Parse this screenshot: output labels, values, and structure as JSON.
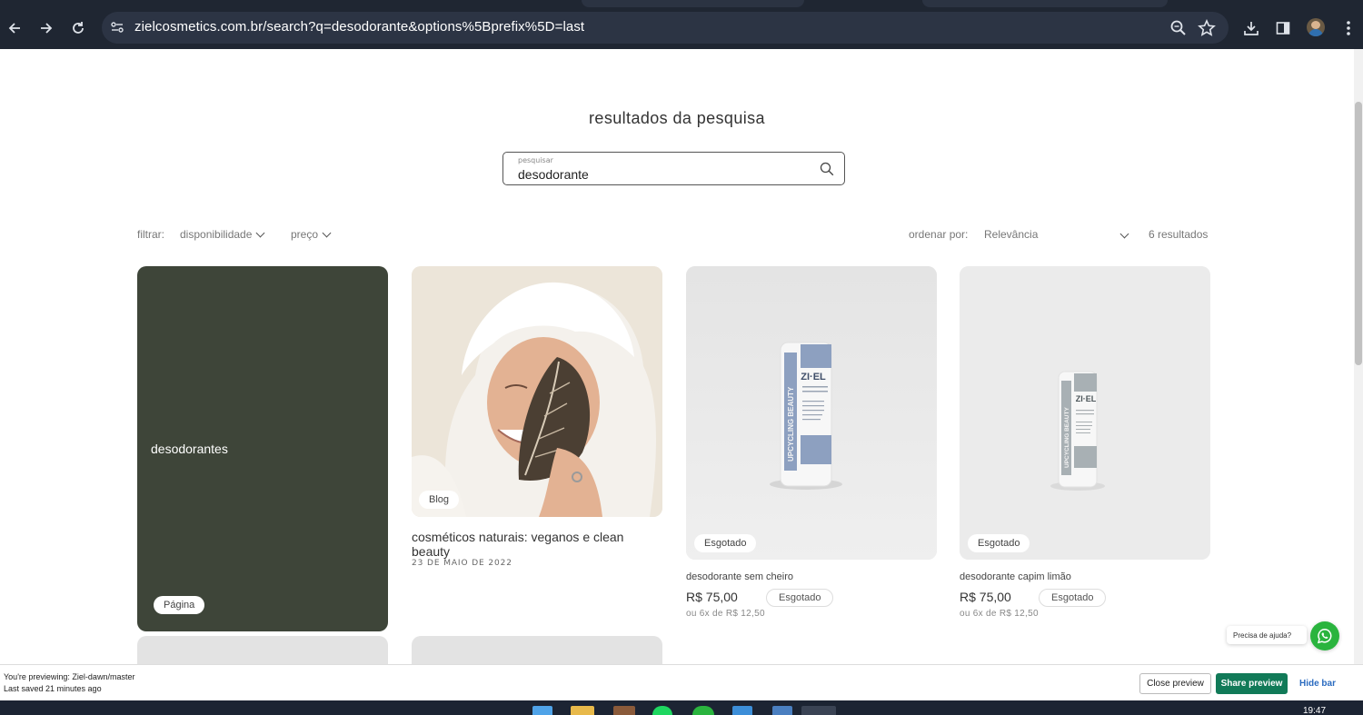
{
  "browser": {
    "url": "zielcosmetics.com.br/search?q=desodorante&options%5Bprefix%5D=last"
  },
  "search": {
    "title": "resultados da pesquisa",
    "label": "pesquisar",
    "value": "desodorante"
  },
  "filters": {
    "filter_label": "filtrar:",
    "availability": "disponibilidade",
    "price": "preço",
    "sort_label": "ordenar por:",
    "sort_value": "Relevância",
    "result_count": "6 resultados"
  },
  "results": {
    "page": {
      "title": "desodorantes",
      "badge": "Página",
      "color": "#3e4539"
    },
    "blog": {
      "badge": "Blog",
      "title": "cosméticos naturais: veganos e clean beauty",
      "date": "23 DE MAIO DE 2022"
    },
    "products": [
      {
        "name": "desodorante sem cheiro",
        "price": "R$ 75,00",
        "status": "Esgotado",
        "installments": "ou 6x de R$ 12,50",
        "brand": "ZI·EL",
        "side_text": "UPCYCLING BEAUTY",
        "accent": "#8da0c0"
      },
      {
        "name": "desodorante capim limão",
        "price": "R$ 75,00",
        "status": "Esgotado",
        "installments": "ou 6x de R$ 12,50",
        "brand": "ZI·EL",
        "side_text": "UPCYCLING BEAUTY",
        "accent": "#a8b0b4"
      }
    ]
  },
  "help": {
    "text": "Precisa de ajuda?",
    "color": "#2ab43e"
  },
  "preview_bar": {
    "previewing": "You're previewing: Ziel-dawn/master",
    "saved": "Last saved 21 minutes ago",
    "close": "Close preview",
    "share": "Share preview",
    "hide": "Hide bar",
    "accent": "#117a58"
  },
  "taskbar": {
    "clock": "19:47"
  }
}
